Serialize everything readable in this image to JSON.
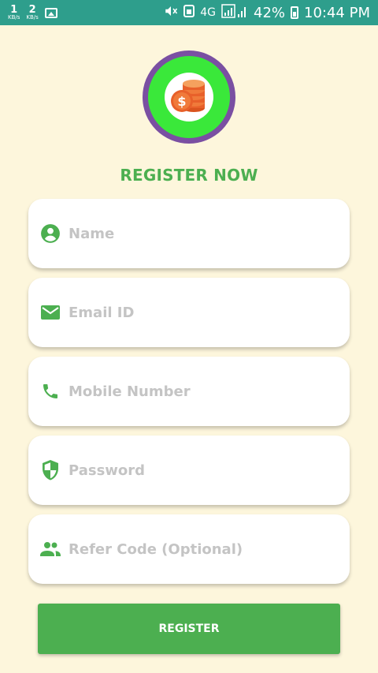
{
  "status_bar": {
    "net_up_value": "1",
    "net_up_unit": "KB/s",
    "net_down_value": "2",
    "net_down_unit": "KB/s",
    "network_type": "4G",
    "battery_percent": "42%",
    "time": "10:44 PM"
  },
  "header": {
    "title": "REGISTER NOW"
  },
  "form": {
    "name_placeholder": "Name",
    "email_placeholder": "Email ID",
    "mobile_placeholder": "Mobile Number",
    "password_placeholder": "Password",
    "refer_placeholder": "Refer Code (Optional)"
  },
  "actions": {
    "register_label": "REGISTER"
  },
  "colors": {
    "accent": "#4caf50",
    "status_bar": "#2e9e8c",
    "background": "#fdf6dc"
  }
}
